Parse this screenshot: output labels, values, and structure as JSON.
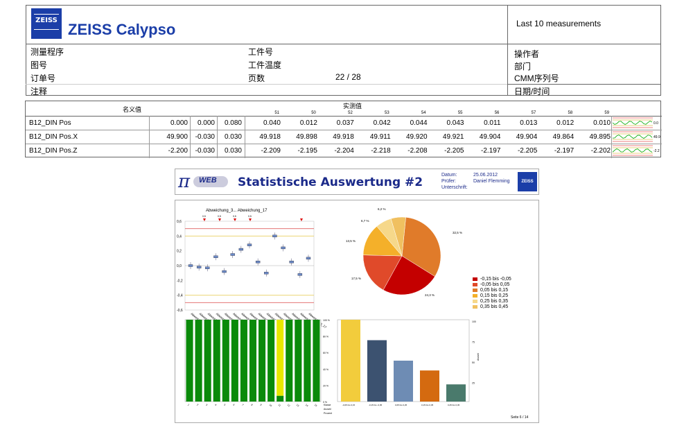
{
  "header": {
    "logo_text": "ZEISS",
    "title": "ZEISS Calypso",
    "right_title": "Last 10 measurements",
    "left_fields": [
      "测量程序",
      "图号",
      "订单号",
      "注释"
    ],
    "mid_fields": [
      "工件号",
      "工件温度",
      "页数"
    ],
    "page_value": "22 / 28",
    "right_fields": [
      "操作者",
      "部门",
      "CMM序列号",
      "日期/时间"
    ]
  },
  "table": {
    "nominal_header": "名义值",
    "measured_header": "实测值",
    "columns": [
      "51",
      "50",
      "52",
      "53",
      "54",
      "55",
      "56",
      "57",
      "58",
      "59"
    ],
    "rows": [
      {
        "name": "B12_DIN Pos",
        "nominal": "0.000",
        "lower": "0.000",
        "upper": "0.080",
        "values": [
          "0.040",
          "0.012",
          "0.037",
          "0.042",
          "0.044",
          "0.043",
          "0.011",
          "0.013",
          "0.012",
          "0.010"
        ],
        "spark": "0.0"
      },
      {
        "name": "B12_DIN Pos.X",
        "nominal": "49.900",
        "lower": "-0.030",
        "upper": "0.030",
        "values": [
          "49.918",
          "49.898",
          "49.918",
          "49.911",
          "49.920",
          "49.921",
          "49.904",
          "49.904",
          "49.864",
          "49.895"
        ],
        "spark": "49.9"
      },
      {
        "name": "B12_DIN Pos.Z",
        "nominal": "-2.200",
        "lower": "-0.030",
        "upper": "0.030",
        "values": [
          "-2.209",
          "-2.195",
          "-2.204",
          "-2.218",
          "-2.208",
          "-2.205",
          "-2.197",
          "-2.205",
          "-2.197",
          "-2.202"
        ],
        "spark": "-2.2"
      }
    ]
  },
  "report": {
    "brand": "WEB",
    "title": "Statistische Auswertung #2",
    "meta_labels": [
      "Datum:",
      "Prüfer:",
      "Unterschrift:"
    ],
    "meta_values": [
      "25.06.2012",
      "Daniel Flemming",
      ""
    ],
    "page_label": "Seite  6 / 14",
    "colors": {
      "title": "#1b2a8a",
      "green": "#0a8a0a",
      "yellow": "#e8e800"
    }
  },
  "chart_data": [
    {
      "type": "scatter",
      "title": "Abweichung_3... Abweichung_17",
      "yticks": [
        "0,6",
        "0,4",
        "0,2",
        "0,0",
        "-0,2",
        "-0,4",
        "-0,6"
      ],
      "ylim": [
        -0.6,
        0.6
      ],
      "x": [
        "Abweichung_3",
        "Abweichung_4",
        "Abweichung_5",
        "Abweichung_6",
        "Abweichung_7",
        "Abweichung_8",
        "Abweichung_9",
        "Abweichung_10",
        "Abweichung_11",
        "Abweichung_12",
        "Abweichung_13",
        "Abweichung_14",
        "Abweichung_15",
        "Abweichung_16",
        "Abweichung_17"
      ],
      "values": [
        0.0,
        -0.02,
        -0.03,
        0.12,
        -0.08,
        0.15,
        0.22,
        0.28,
        0.05,
        -0.1,
        0.4,
        0.24,
        0.05,
        -0.12,
        0.1
      ],
      "top_flags": [
        "0,5",
        "0,5",
        "0,5",
        "0,5"
      ]
    },
    {
      "type": "pie",
      "values": [
        32.5,
        24.3,
        17.5,
        13.5,
        6.7,
        6.2
      ],
      "labels": [
        "32,5 %",
        "24,3 %",
        "17,5 %",
        "13,5 %",
        "6,7 %",
        "6,2 %"
      ],
      "legend": [
        "-0,15 bis -0,05",
        "-0,05 bis 0,05",
        "0,05 bis 0,15",
        "0,15 bis 0,25",
        "0,25 bis 0,35",
        "0,35 bis 0,45"
      ],
      "colors": [
        "#e07b2a",
        "#c40000",
        "#e04a2a",
        "#f4b02a",
        "#f6d88a",
        "#f0c060"
      ]
    },
    {
      "type": "bar",
      "stacked": true,
      "yticks": [
        "100 %",
        "80 %",
        "60 %",
        "40 %",
        "20 %",
        "0 %"
      ],
      "categories": [
        "1",
        "2",
        "3",
        "4",
        "5",
        "6",
        "7",
        "8",
        "9",
        "10",
        "11",
        "12",
        "13",
        "14",
        "15"
      ],
      "green": [
        100,
        100,
        100,
        100,
        100,
        100,
        100,
        100,
        100,
        100,
        7,
        100,
        100,
        100,
        100
      ],
      "yellow": [
        0,
        0,
        0,
        0,
        0,
        0,
        0,
        0,
        0,
        0,
        93,
        0,
        0,
        0,
        0
      ]
    },
    {
      "type": "bar",
      "categories": [
        "-0,05 bis 0,15",
        "-0,15 bis -0,05",
        "0,05 bis 0,25",
        "0,15 bis 0,35",
        "0,25 bis 0,45"
      ],
      "values": [
        100,
        75,
        50,
        38,
        21
      ],
      "colors": [
        "#f2cc3c",
        "#3c5270",
        "#6e8cb4",
        "#d46a10",
        "#4a7a6c"
      ],
      "yticks": [
        "100",
        "75",
        "50",
        "25"
      ],
      "ylabel": "Anzahl",
      "footer_labels": [
        "Klasse",
        "Anzahl",
        "Prozent"
      ]
    }
  ]
}
